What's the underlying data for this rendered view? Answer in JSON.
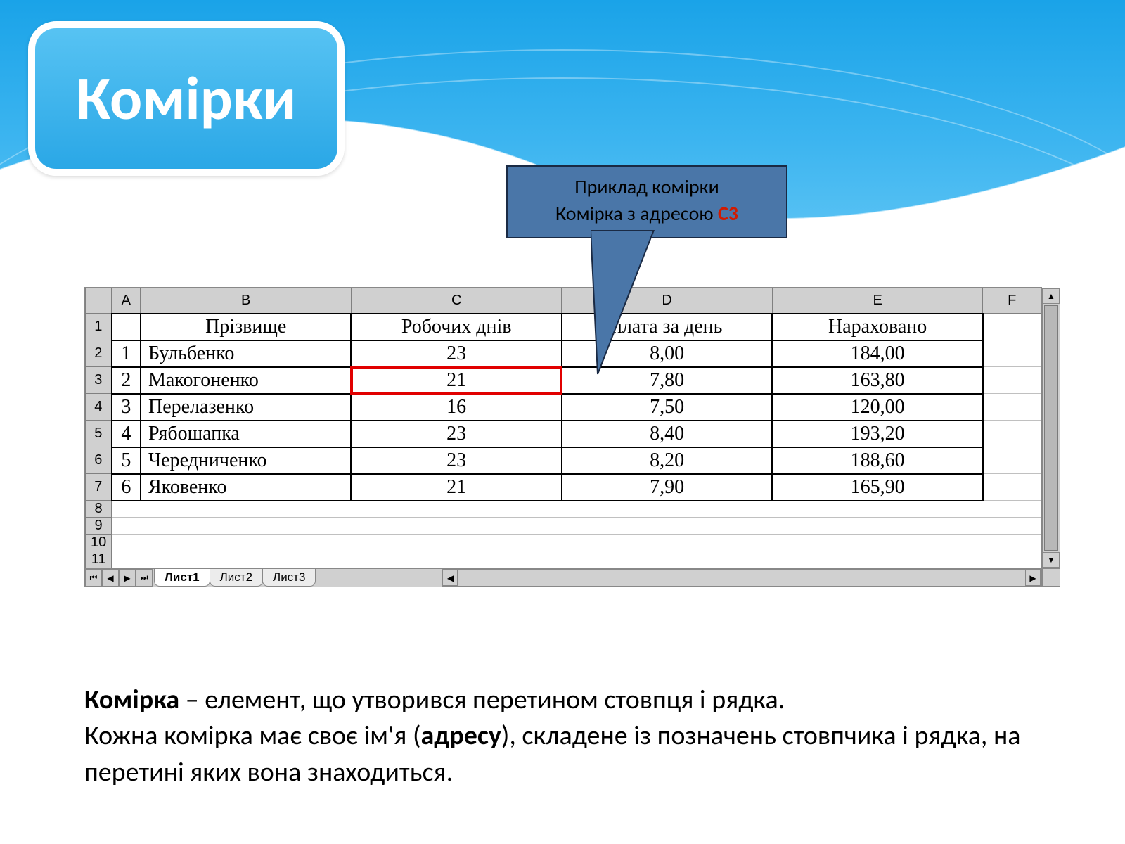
{
  "title": "Комірки",
  "callout": {
    "line1": "Приклад комірки",
    "line2_prefix": "Комірка з адресою ",
    "address": "С3"
  },
  "sheet": {
    "columns": [
      "A",
      "B",
      "C",
      "D",
      "E",
      "F"
    ],
    "header_row": {
      "a": "",
      "b": "Прізвище",
      "c": "Робочих днів",
      "d": "плата за день",
      "e": "Нараховано"
    },
    "rows": [
      {
        "n": "1",
        "name": "Бульбенко",
        "days": "23",
        "rate": "8,00",
        "total": "184,00"
      },
      {
        "n": "2",
        "name": "Макогоненко",
        "days": "21",
        "rate": "7,80",
        "total": "163,80"
      },
      {
        "n": "3",
        "name": "Перелазенко",
        "days": "16",
        "rate": "7,50",
        "total": "120,00"
      },
      {
        "n": "4",
        "name": "Рябошапка",
        "days": "23",
        "rate": "8,40",
        "total": "193,20"
      },
      {
        "n": "5",
        "name": "Чередниченко",
        "days": "23",
        "rate": "8,20",
        "total": "188,60"
      },
      {
        "n": "6",
        "name": "Яковенко",
        "days": "21",
        "rate": "7,90",
        "total": "165,90"
      }
    ],
    "row_numbers": [
      "1",
      "2",
      "3",
      "4",
      "5",
      "6",
      "7",
      "8",
      "9",
      "10",
      "11"
    ],
    "highlight_cell": "C3",
    "tabs": [
      "Лист1",
      "Лист2",
      "Лист3"
    ],
    "active_tab": 0
  },
  "definition": {
    "term": "Комірка",
    "body1": " – елемент, що утворився перетином стовпця і рядка.",
    "body2_a": "Кожна комірка має своє ім'я (",
    "body2_bold": "адресу",
    "body2_b": "), складене із позначень стовпчика і рядка, на перетині яких вона знаходиться."
  }
}
